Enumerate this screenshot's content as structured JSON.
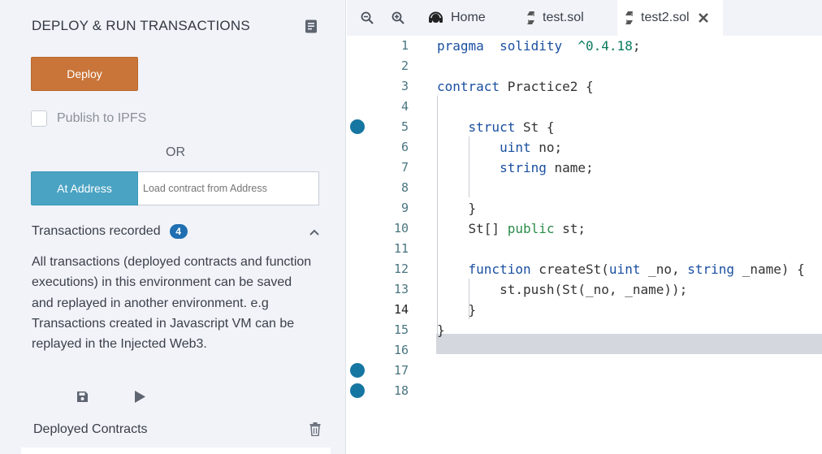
{
  "left_panel": {
    "title": "DEPLOY & RUN TRANSACTIONS",
    "deploy_label": "Deploy",
    "ipfs_label": "Publish to IPFS",
    "or_label": "OR",
    "at_address_label": "At Address",
    "address_placeholder": "Load contract from Address",
    "transactions_label": "Transactions recorded",
    "transactions_count": "4",
    "transactions_description": "All transactions (deployed contracts and function executions) in this environment can be saved and replayed in another environment. e.g Transactions created in Javascript VM can be replayed in the Injected Web3.",
    "deployed_contracts_label": "Deployed Contracts"
  },
  "editor": {
    "tabs": [
      {
        "label": "Home",
        "icon": "headset-icon"
      },
      {
        "label": "test.sol",
        "icon": "solidity-icon"
      },
      {
        "label": "test2.sol",
        "icon": "solidity-icon",
        "active": true
      }
    ],
    "active_line": 14,
    "breakpoints": [
      5,
      17,
      18
    ],
    "lines": [
      {
        "n": "1",
        "tokens": [
          [
            "kw",
            "pragma"
          ],
          [
            "",
            "  "
          ],
          [
            "kw",
            "solidity"
          ],
          [
            "",
            "  "
          ],
          [
            "num",
            "^0.4.18"
          ],
          [
            "",
            ";"
          ]
        ]
      },
      {
        "n": "2",
        "tokens": []
      },
      {
        "n": "3",
        "tokens": [
          [
            "kw",
            "contract"
          ],
          [
            "",
            " Practice2 {"
          ]
        ]
      },
      {
        "n": "4",
        "tokens": []
      },
      {
        "n": "5",
        "tokens": [
          [
            "",
            "    "
          ],
          [
            "kw",
            "struct"
          ],
          [
            "",
            " St {"
          ]
        ]
      },
      {
        "n": "6",
        "tokens": [
          [
            "",
            "        "
          ],
          [
            "ty",
            "uint"
          ],
          [
            "",
            " no;"
          ]
        ]
      },
      {
        "n": "7",
        "tokens": [
          [
            "",
            "        "
          ],
          [
            "ty",
            "string"
          ],
          [
            "",
            " name;"
          ]
        ]
      },
      {
        "n": "8",
        "tokens": []
      },
      {
        "n": "9",
        "tokens": [
          [
            "",
            "    }"
          ]
        ]
      },
      {
        "n": "10",
        "tokens": [
          [
            "",
            "    St[] "
          ],
          [
            "vis",
            "public"
          ],
          [
            "",
            " st;"
          ]
        ]
      },
      {
        "n": "11",
        "tokens": []
      },
      {
        "n": "12",
        "tokens": [
          [
            "",
            "    "
          ],
          [
            "kw",
            "function"
          ],
          [
            "",
            " createSt("
          ],
          [
            "ty",
            "uint"
          ],
          [
            "",
            " _no, "
          ],
          [
            "ty",
            "string"
          ],
          [
            "",
            " _name) {"
          ]
        ]
      },
      {
        "n": "13",
        "tokens": [
          [
            "",
            "        st.push(St(_no, _name));"
          ]
        ]
      },
      {
        "n": "14",
        "tokens": [
          [
            "",
            "    }"
          ]
        ]
      },
      {
        "n": "15",
        "tokens": [
          [
            "",
            "}"
          ]
        ]
      },
      {
        "n": "16",
        "tokens": []
      },
      {
        "n": "17",
        "tokens": []
      },
      {
        "n": "18",
        "tokens": []
      }
    ]
  },
  "colors": {
    "deploy": "#c97539",
    "at_address": "#4aa3c3",
    "badge": "#1f6fb2",
    "breakpoint": "#1676a2",
    "keyword": "#1a4fa0",
    "visibility": "#2b8c4a"
  }
}
